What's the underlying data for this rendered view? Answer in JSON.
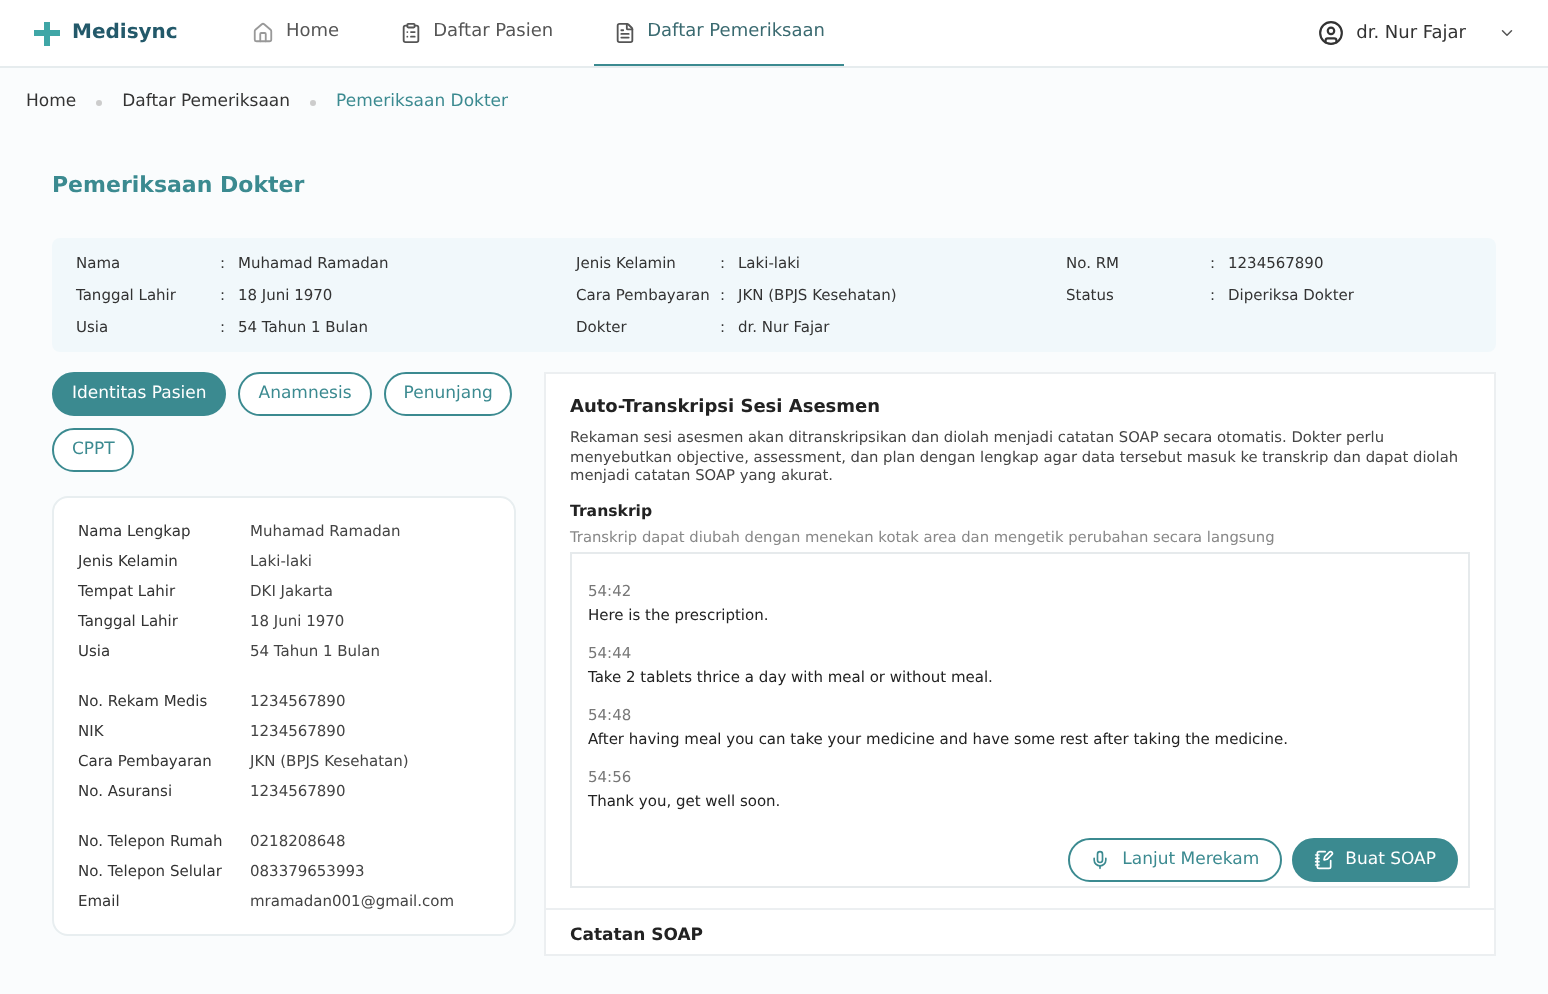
{
  "brand": "Medisync",
  "nav": [
    {
      "label": "Home",
      "selected": false,
      "kind": "home"
    },
    {
      "label": "Daftar Pasien",
      "selected": false,
      "kind": "list"
    },
    {
      "label": "Daftar Pemeriksaan",
      "selected": true,
      "kind": "doc"
    }
  ],
  "user": "dr. Nur Fajar",
  "breadcrumb": [
    "Home",
    "Daftar Pemeriksaan",
    "Pemeriksaan Dokter"
  ],
  "title": "Pemeriksaan Dokter",
  "summary": [
    [
      {
        "label": "Nama",
        "sep": ":",
        "value": "Muhamad Ramadan"
      },
      {
        "label": "Tanggal Lahir",
        "sep": ":",
        "value": "18 Juni 1970"
      },
      {
        "label": "Usia",
        "sep": ":",
        "value": "54 Tahun 1 Bulan"
      }
    ],
    [
      {
        "label": "Jenis Kelamin",
        "sep": ":",
        "value": "Laki-laki"
      },
      {
        "label": "Cara Pembayaran",
        "sep": ":",
        "value": "JKN (BPJS Kesehatan)"
      },
      {
        "label": "Dokter",
        "sep": ":",
        "value": "dr. Nur Fajar"
      }
    ],
    [
      {
        "label": "No. RM",
        "sep": ":",
        "value": "1234567890"
      },
      {
        "label": "Status",
        "sep": ":",
        "value": "Diperiksa Dokter"
      }
    ]
  ],
  "tabs": [
    {
      "label": "Identitas Pasien",
      "selected": true
    },
    {
      "label": "Anamnesis",
      "selected": false
    },
    {
      "label": "Penunjang",
      "selected": false
    },
    {
      "label": "CPPT",
      "selected": false
    }
  ],
  "identity": [
    [
      {
        "label": "Nama Lengkap",
        "value": "Muhamad Ramadan"
      },
      {
        "label": "Jenis Kelamin",
        "value": "Laki-laki"
      },
      {
        "label": "Tempat Lahir",
        "value": "DKI Jakarta"
      },
      {
        "label": "Tanggal Lahir",
        "value": "18 Juni 1970"
      },
      {
        "label": "Usia",
        "value": "54 Tahun 1 Bulan"
      }
    ],
    [
      {
        "label": "No. Rekam Medis",
        "value": "1234567890"
      },
      {
        "label": "NIK",
        "value": "1234567890"
      },
      {
        "label": "Cara Pembayaran",
        "value": "JKN (BPJS Kesehatan)"
      },
      {
        "label": "No. Asuransi",
        "value": "1234567890"
      }
    ],
    [
      {
        "label": "No. Telepon Rumah",
        "value": "0218208648"
      },
      {
        "label": "No. Telepon Selular",
        "value": "083379653993"
      },
      {
        "label": "Email",
        "value": "mramadan001@gmail.com"
      }
    ]
  ],
  "transcription": {
    "title": "Auto-Transkripsi Sesi Asesmen",
    "description": "Rekaman sesi asesmen akan ditranskripsikan dan diolah menjadi catatan SOAP secara otomatis. Dokter perlu menyebutkan objective, assessment, dan plan dengan lengkap agar data tersebut masuk ke transkrip dan dapat diolah menjadi catatan SOAP yang akurat.",
    "transcript_label": "Transkrip",
    "transcript_hint": "Transkrip dapat diubah dengan menekan kotak area dan mengetik perubahan secara langsung",
    "entries": [
      {
        "time": "54:42",
        "text": "Here is the prescription."
      },
      {
        "time": "54:44",
        "text": "Take 2 tablets thrice a day with meal or without meal."
      },
      {
        "time": "54:48",
        "text": "After having meal you can take your medicine and have some rest after taking the medicine."
      },
      {
        "time": "54:56",
        "text": "Thank you, get well soon."
      }
    ],
    "buttons": [
      {
        "label": "Lanjut Merekam",
        "kind": "secondary"
      },
      {
        "label": "Buat SOAP",
        "kind": "primary"
      }
    ]
  },
  "soap_title": "Catatan SOAP"
}
